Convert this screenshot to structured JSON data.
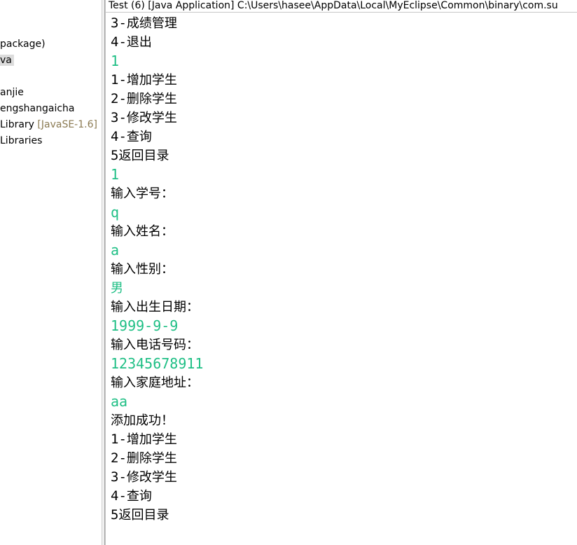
{
  "explorer": {
    "items": [
      {
        "label": "package)",
        "decoration": ""
      },
      {
        "label": "va",
        "decoration": "",
        "selected": true
      },
      {
        "label": "anjie",
        "decoration": ""
      },
      {
        "label": "engshangaicha",
        "decoration": ""
      },
      {
        "label": "Library",
        "decoration": "[JavaSE-1.6]"
      },
      {
        "label": "Libraries",
        "decoration": ""
      }
    ]
  },
  "console": {
    "header": "Test (6) [Java Application] C:\\Users\\hasee\\AppData\\Local\\MyEclipse\\Common\\binary\\com.su",
    "lines": [
      {
        "num": "3-",
        "text": "成绩管理"
      },
      {
        "num": "4-",
        "text": "退出"
      },
      {
        "input": "1"
      },
      {
        "num": "1-",
        "text": "增加学生"
      },
      {
        "num": "2-",
        "text": "删除学生"
      },
      {
        "num": "3-",
        "text": "修改学生"
      },
      {
        "num": "4-",
        "text": "查询"
      },
      {
        "num": "5",
        "text": "返回目录"
      },
      {
        "input": "1"
      },
      {
        "num": "",
        "text": "输入学号："
      },
      {
        "input": "q"
      },
      {
        "num": "",
        "text": "输入姓名："
      },
      {
        "input": "a"
      },
      {
        "num": "",
        "text": "输入性别："
      },
      {
        "input": "男",
        "cjk": true
      },
      {
        "num": "",
        "text": "输入出生日期："
      },
      {
        "input": "1999-9-9"
      },
      {
        "num": "",
        "text": "输入电话号码："
      },
      {
        "input": "12345678911"
      },
      {
        "num": "",
        "text": "输入家庭地址："
      },
      {
        "input": "aa"
      },
      {
        "num": "",
        "text": "添加成功！"
      },
      {
        "num": "1-",
        "text": "增加学生"
      },
      {
        "num": "2-",
        "text": "删除学生"
      },
      {
        "num": "3-",
        "text": "修改学生"
      },
      {
        "num": "4-",
        "text": "查询"
      },
      {
        "num": "5",
        "text": "返回目录"
      }
    ]
  },
  "colors": {
    "input_text": "#1fbf85",
    "decoration_text": "#8b7a52",
    "selection_bg": "#dcdcdc"
  }
}
